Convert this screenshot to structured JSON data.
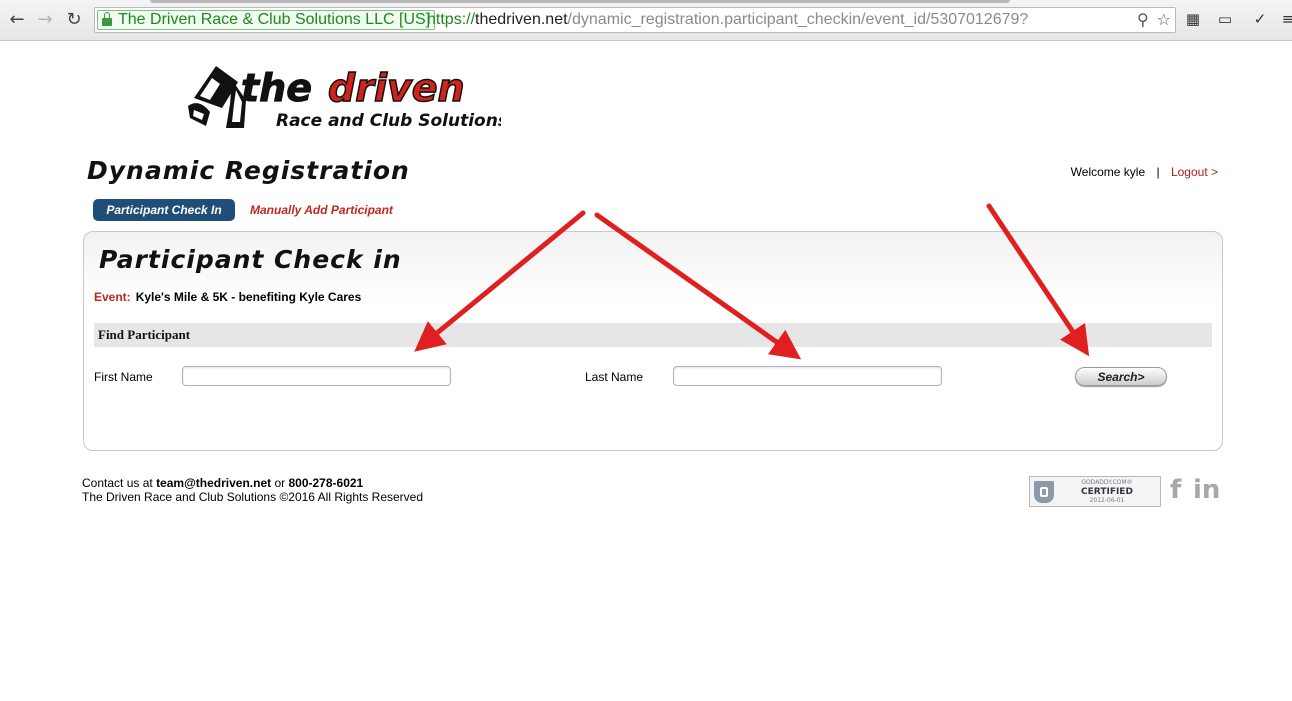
{
  "browser": {
    "ev_badge": "The Driven Race & Club Solutions LLC [US]",
    "url_scheme": "https://",
    "url_host": "thedriven.net",
    "url_path": "/dynamic_registration.participant_checkin/event_id/5307012679?",
    "icons": [
      "back-arrow-icon",
      "forward-arrow-icon",
      "reload-icon",
      "lock-icon",
      "key-icon",
      "star-icon",
      "film-icon",
      "cast-icon",
      "eyedropper-icon",
      "menu-icon"
    ]
  },
  "brand": {
    "logo_word_the": "the",
    "logo_word_driven": "driven",
    "logo_tagline": "Race and Club Solutions",
    "logo_colors": {
      "dark": "#111111",
      "red": "#d2231b"
    }
  },
  "header": {
    "title": "Dynamic Registration",
    "welcome_prefix": "Welcome",
    "username": "kyle",
    "separator": "|",
    "logout": "Logout >"
  },
  "tabs": {
    "active": "Participant Check In",
    "manual": "Manually Add Participant"
  },
  "panel": {
    "title": "Participant Check in",
    "event_label": "Event:",
    "event_name": "Kyle's Mile & 5K - benefiting Kyle Cares",
    "find_heading": "Find Participant",
    "first_name_label": "First Name",
    "first_name_value": "",
    "last_name_label": "Last Name",
    "last_name_value": "",
    "search_button": "Search>"
  },
  "footer": {
    "contact_prefix": "Contact us at",
    "email": "team@thedriven.net",
    "or": "or",
    "phone": "800-278-6021",
    "copyright": "The Driven Race and Club Solutions ©2016 All Rights Reserved",
    "badge_line1": "GODADDY.COM®",
    "badge_line2": "CERTIFIED",
    "badge_line3": "2012-06-01",
    "social": [
      "facebook-icon",
      "linkedin-icon"
    ]
  },
  "colors": {
    "accent_red": "#c0281e",
    "tab_blue": "#1f4e79",
    "annotation_arrow": "#e02020"
  }
}
